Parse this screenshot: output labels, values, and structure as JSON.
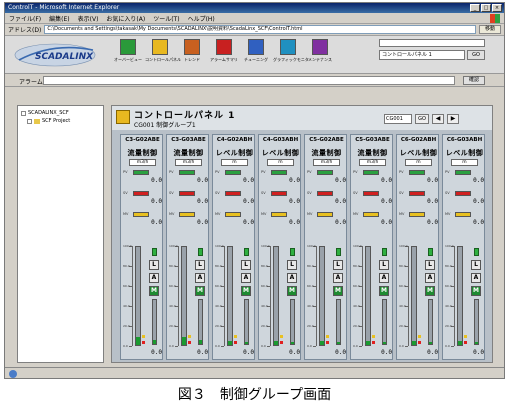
{
  "window": {
    "title": "ControlT - Microsoft Internet Explorer"
  },
  "menu": {
    "items": [
      "ファイル(F)",
      "編集(E)",
      "表示(V)",
      "お気に入り(A)",
      "ツール(T)",
      "ヘルプ(H)"
    ]
  },
  "address": {
    "label": "アドレス(D)",
    "url": "C:\\Documents and Settings\\takasak\\My Documents\\SCADALINX\\説明資料\\ScadaLinx_SCF\\ControlT.html",
    "go_label": "移動"
  },
  "toolbar": {
    "logo_text": "SCADALINX",
    "buttons": [
      {
        "label": "オーバービュー",
        "icon": "overview-grid-icon",
        "color": "#2a9a3a"
      },
      {
        "label": "コントロールパネル",
        "icon": "control-panel-icon",
        "color": "#e8b820"
      },
      {
        "label": "トレンド",
        "icon": "trend-icon",
        "color": "#c86020"
      },
      {
        "label": "アラームサマリ",
        "icon": "alarm-icon",
        "color": "#c82020"
      },
      {
        "label": "チューニング",
        "icon": "tuning-icon",
        "color": "#3060c0"
      },
      {
        "label": "グラフィックモニタ",
        "icon": "graphic-monitor-icon",
        "color": "#2090c0"
      },
      {
        "label": "メンテナンス",
        "icon": "maintenance-icon",
        "color": "#8030a0"
      }
    ],
    "panel_select": "コントロールパネル 1",
    "panel_go": "GO"
  },
  "alarm": {
    "label": "アラーム",
    "value": "",
    "confirm_label": "確認"
  },
  "tree": {
    "root": "SCADALINX_SCF",
    "child": "SCF Project"
  },
  "panel": {
    "title": "コントロールパネル 1",
    "subtitle": "CG001  制御グループ1",
    "code": "CG001",
    "go_label": "GO"
  },
  "faceplates": [
    {
      "tag": "C3-G02ABE",
      "name": "流量制御",
      "unit": "m3/h",
      "pv": "0.0",
      "sv": "0.0",
      "mv": "0.0",
      "scale": [
        "100.0",
        "80.0",
        "60.0",
        "40.0",
        "20.0",
        "0.0"
      ],
      "mode": [
        "L",
        "A",
        "M"
      ],
      "active_mode": "M",
      "out": "0.0",
      "fill": 0.08
    },
    {
      "tag": "C3-G03ABE",
      "name": "流量制御",
      "unit": "m3/h",
      "pv": "0.0",
      "sv": "0.0",
      "mv": "0.0",
      "scale": [
        "100.0",
        "80.0",
        "60.0",
        "40.0",
        "20.0",
        "0.0"
      ],
      "mode": [
        "L",
        "A",
        "M"
      ],
      "active_mode": "M",
      "out": "0.0",
      "fill": 0.08
    },
    {
      "tag": "C4-G02ABH",
      "name": "レベル制御",
      "unit": "m",
      "pv": "0.0",
      "sv": "0.0",
      "mv": "0.0",
      "scale": [
        "100.0",
        "80.0",
        "60.0",
        "40.0",
        "20.0",
        "0.0"
      ],
      "mode": [
        "L",
        "A",
        "M"
      ],
      "active_mode": "M",
      "out": "0.0",
      "fill": 0.04
    },
    {
      "tag": "C4-G03ABH",
      "name": "レベル制御",
      "unit": "m",
      "pv": "0.0",
      "sv": "0.0",
      "mv": "0.0",
      "scale": [
        "100.0",
        "80.0",
        "60.0",
        "40.0",
        "20.0",
        "0.0"
      ],
      "mode": [
        "L",
        "A",
        "M"
      ],
      "active_mode": "M",
      "out": "0.0",
      "fill": 0.04
    },
    {
      "tag": "C5-G02ABE",
      "name": "流量制御",
      "unit": "m3/h",
      "pv": "0.0",
      "sv": "0.0",
      "mv": "0.0",
      "scale": [
        "100.0",
        "80.0",
        "60.0",
        "40.0",
        "20.0",
        "0.0"
      ],
      "mode": [
        "L",
        "A",
        "M"
      ],
      "active_mode": "M",
      "out": "0.0",
      "fill": 0.04
    },
    {
      "tag": "C5-G03ABE",
      "name": "流量制御",
      "unit": "m3/h",
      "pv": "0.0",
      "sv": "0.0",
      "mv": "0.0",
      "scale": [
        "100.0",
        "80.0",
        "60.0",
        "40.0",
        "20.0",
        "0.0"
      ],
      "mode": [
        "L",
        "A",
        "M"
      ],
      "active_mode": "M",
      "out": "0.0",
      "fill": 0.04
    },
    {
      "tag": "C6-G02ABH",
      "name": "レベル制御",
      "unit": "m",
      "pv": "0.0",
      "sv": "0.0",
      "mv": "0.0",
      "scale": [
        "100.0",
        "80.0",
        "60.0",
        "40.0",
        "20.0",
        "0.0"
      ],
      "mode": [
        "L",
        "A",
        "M"
      ],
      "active_mode": "M",
      "out": "0.0",
      "fill": 0.04
    },
    {
      "tag": "C6-G03ABH",
      "name": "レベル制御",
      "unit": "m",
      "pv": "0.0",
      "sv": "0.0",
      "mv": "0.0",
      "scale": [
        "100.0",
        "80.0",
        "60.0",
        "40.0",
        "20.0",
        "0.0"
      ],
      "mode": [
        "L",
        "A",
        "M"
      ],
      "active_mode": "M",
      "out": "0.0",
      "fill": 0.04
    }
  ],
  "caption": "図３　制御グループ画面"
}
